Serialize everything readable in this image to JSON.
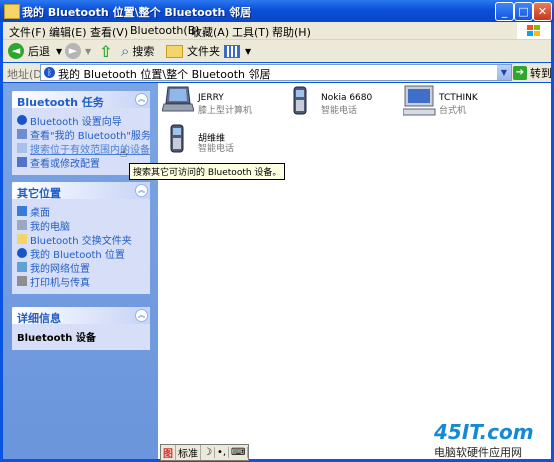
{
  "window": {
    "title": "我的 Bluetooth 位置\\整个 Bluetooth 邻居",
    "minimize": "_",
    "maximize": "□",
    "close": "✕"
  },
  "menu": [
    "文件(F)",
    "编辑(E)",
    "查看(V)",
    "Bluetooth(B)",
    "收藏(A)",
    "工具(T)",
    "帮助(H)"
  ],
  "toolbar": {
    "back": "后退",
    "search": "搜索",
    "folders": "文件夹"
  },
  "address": {
    "label": "地址(D)",
    "value": "我的 Bluetooth 位置\\整个 Bluetooth 邻居",
    "go": "转到"
  },
  "panels": {
    "bluetooth_tasks": {
      "title": "Bluetooth 任务",
      "links": [
        "Bluetooth 设置向导",
        "查看\"我的 Bluetooth\"服务",
        "搜索位于有效范围内的设备",
        "查看或修改配置"
      ]
    },
    "other_places": {
      "title": "其它位置",
      "links": [
        "桌面",
        "我的电脑",
        "Bluetooth 交换文件夹",
        "我的 Bluetooth 位置",
        "我的网络位置",
        "打印机与传真"
      ]
    },
    "details": {
      "title": "详细信息",
      "text": "Bluetooth 设备"
    }
  },
  "devices": [
    {
      "name": "JERRY",
      "type": "膝上型计算机",
      "icon": "laptop-icon"
    },
    {
      "name": "Nokia 6680",
      "type": "智能电话",
      "icon": "phone-icon"
    },
    {
      "name": "TCTHINK",
      "type": "台式机",
      "icon": "desktop-icon"
    },
    {
      "name": "胡维维",
      "type": "智能电话",
      "icon": "phone-icon"
    }
  ],
  "tooltip": "搜索其它可访问的 Bluetooth 设备。",
  "ime": [
    "标准",
    "☽",
    "•,",
    "⌨"
  ],
  "watermark": {
    "logo": "45IT.com",
    "text": "电脑软硬件应用网"
  },
  "colors": {
    "titlebar": "#0b4fd8",
    "left_pane": "#7ba4e3",
    "panel_body": "#d6dff7",
    "link": "#215dc6",
    "chrome": "#ece9d8"
  }
}
